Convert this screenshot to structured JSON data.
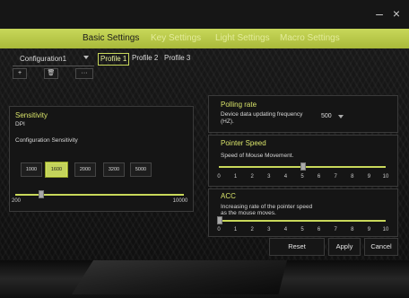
{
  "window": {
    "minimize_icon": "–",
    "close_icon": "×"
  },
  "tabs": [
    {
      "label": "Basic Settings",
      "active": true
    },
    {
      "label": "Key Settings",
      "active": false
    },
    {
      "label": "Light Settings",
      "active": false
    },
    {
      "label": "Macro Settings",
      "active": false
    }
  ],
  "config": {
    "name": "Configuration1",
    "profiles": [
      {
        "label": "Profile 1",
        "active": true
      },
      {
        "label": "Profile 2",
        "active": false
      },
      {
        "label": "Profile 3",
        "active": false
      }
    ],
    "add_label": "+",
    "delete_label": "🗑",
    "more_label": "···"
  },
  "sensitivity": {
    "title": "Sensitivity",
    "subtitle": "DPI",
    "config_label": "Configuration Sensitivity",
    "dpi_options": [
      "1000",
      "1600",
      "2000",
      "3200",
      "5000"
    ],
    "selected": "1600",
    "range_min": "200",
    "range_max": "10000",
    "slider_fraction": 0.15
  },
  "polling": {
    "title": "Polling rate",
    "desc": "Device data updating frequency (HZ).",
    "value": "500"
  },
  "pointer": {
    "title": "Pointer Speed",
    "desc": "Speed of Mouse Movement.",
    "scale": [
      "0",
      "1",
      "2",
      "3",
      "4",
      "5",
      "6",
      "7",
      "8",
      "9",
      "10"
    ],
    "value": 5
  },
  "acc": {
    "title": "ACC",
    "desc_line1": "Increasing rate of the pointer speed",
    "desc_line2": "as the mouse moves.",
    "scale": [
      "0",
      "1",
      "2",
      "3",
      "4",
      "5",
      "6",
      "7",
      "8",
      "9",
      "10"
    ],
    "value": 0
  },
  "actions": {
    "reset": "Reset",
    "apply": "Apply",
    "cancel": "Cancel"
  },
  "colors": {
    "accent": "#c8d85a"
  }
}
